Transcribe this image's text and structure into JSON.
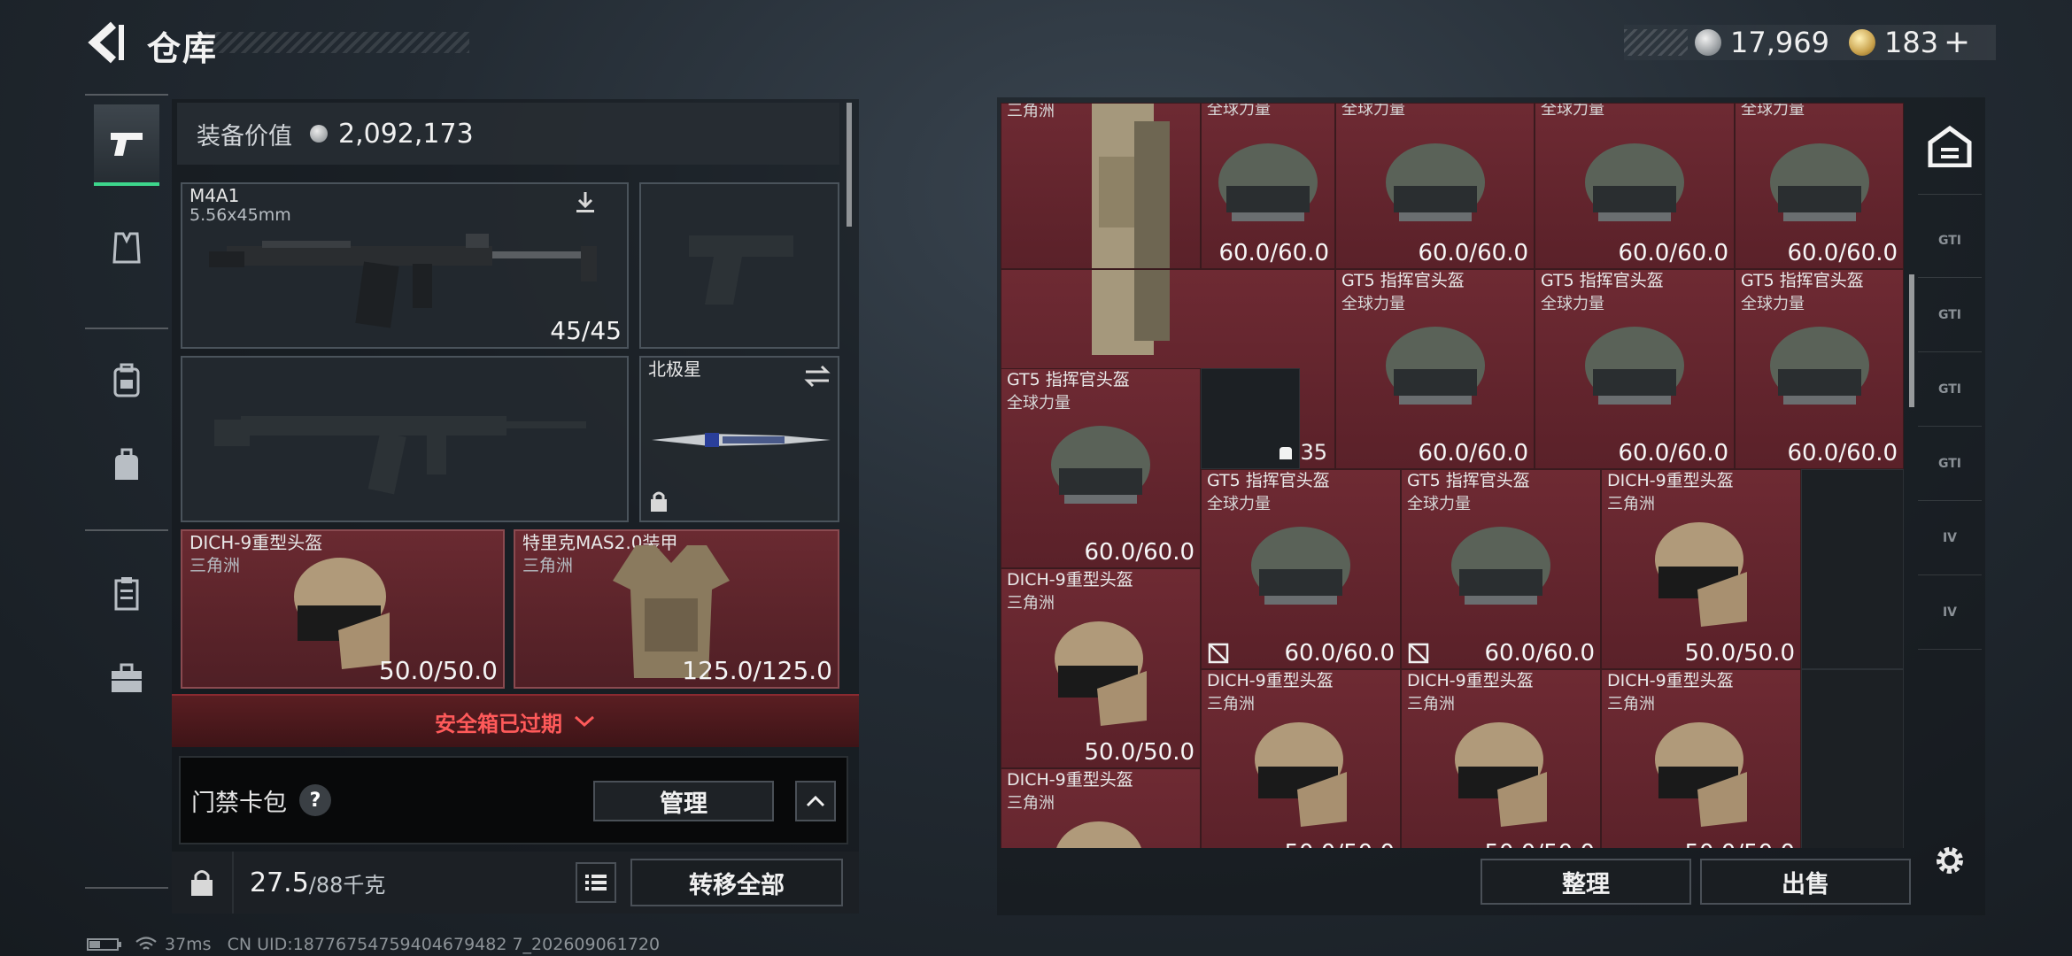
{
  "header": {
    "title": "仓库",
    "currency_primary": "17,969",
    "currency_secondary": "183",
    "plus_symbol": "+"
  },
  "left_nav": {
    "items": [
      "pistol-icon",
      "armor-icon",
      "backpack-icon",
      "bag-icon",
      "clipboard-icon",
      "briefcase-icon"
    ],
    "active_index": 0
  },
  "loadout": {
    "equip_value_label": "装备价值",
    "equip_value": "2,092,173",
    "primary_weapon": {
      "name": "M4A1",
      "caliber": "5.56x45mm",
      "ammo": "45/45"
    },
    "melee": {
      "name": "北极星"
    },
    "helmet": {
      "name": "DICH-9重型头盔",
      "sub": "三角洲",
      "durability": "50.0/50.0"
    },
    "armor": {
      "name": "特里克MAS2.0装甲",
      "sub": "三角洲",
      "durability": "125.0/125.0"
    },
    "safe_box_expired": "安全箱已过期",
    "keycard_label": "门禁卡包",
    "keycard_help": "?",
    "manage_label": "管理",
    "weight": "27.5",
    "weight_cap": "/88千克",
    "transfer_all_label": "转移全部"
  },
  "warehouse": {
    "top_row_sub": "三角洲",
    "top_row_sub_2": "全球力量",
    "bag_count": "35",
    "items": [
      {
        "name": "GT5 指挥官头盔",
        "sub": "全球力量",
        "val": "60.0/60.0"
      },
      {
        "name": "DICH-9重型头盔",
        "sub": "三角洲",
        "val": "50.0/50.0"
      }
    ],
    "sort_label": "整理",
    "sell_label": "出售"
  },
  "right_tabs": [
    "GTI",
    "GTI",
    "GTI",
    "GTI",
    "IV",
    "IV"
  ],
  "status_bar": {
    "ping": "37ms",
    "uid": "CN UID:18776754759404679482 7_202609061720"
  },
  "colors": {
    "accent_green": "#3dd68c",
    "item_red": "#6e2a33",
    "warning_red": "#ff5a5a"
  }
}
